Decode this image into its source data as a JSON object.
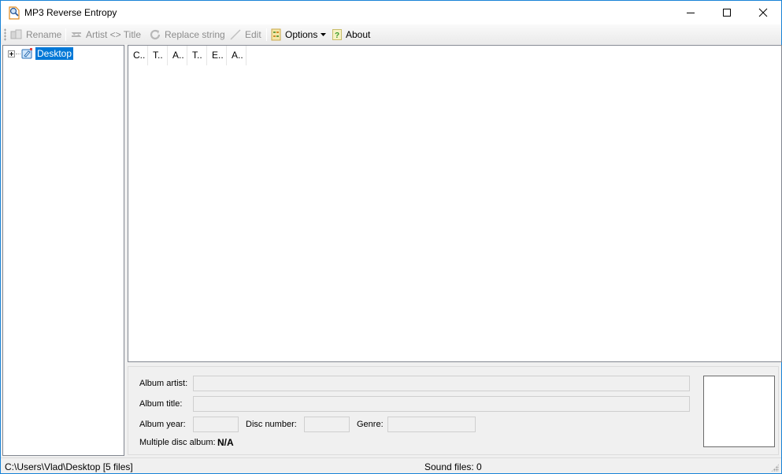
{
  "window": {
    "title": "MP3 Reverse Entropy",
    "controls": {
      "minimize": "minimize",
      "maximize": "maximize",
      "close": "close"
    }
  },
  "toolbar": {
    "items": [
      {
        "label": "Rename",
        "icon": "rename-icon",
        "enabled": false
      },
      {
        "label": "Artist <> Title",
        "icon": "swap-icon",
        "enabled": false
      },
      {
        "label": "Replace string",
        "icon": "refresh-icon",
        "enabled": false
      },
      {
        "label": "Edit",
        "icon": "pencil-icon",
        "enabled": false
      },
      {
        "label": "Options",
        "icon": "options-icon",
        "enabled": true,
        "dropdown": true
      },
      {
        "label": "About",
        "icon": "help-icon",
        "enabled": true
      }
    ]
  },
  "tree": {
    "nodes": [
      {
        "label": "Desktop",
        "selected": true,
        "expandable": true
      }
    ]
  },
  "list": {
    "columns": [
      "C..",
      "T..",
      "A..",
      "T..",
      "E..",
      "A.."
    ],
    "rows": []
  },
  "details": {
    "album_artist_label": "Album artist:",
    "album_artist_value": "",
    "album_title_label": "Album title:",
    "album_title_value": "",
    "album_year_label": "Album year:",
    "album_year_value": "",
    "disc_number_label": "Disc number:",
    "disc_number_value": "",
    "genre_label": "Genre:",
    "genre_value": "",
    "multi_disc_label": "Multiple disc album:",
    "multi_disc_value": "N/A"
  },
  "status": {
    "path": "C:\\Users\\Vlad\\Desktop [5 files]",
    "sound_files": "Sound files: 0"
  },
  "colors": {
    "accent": "#0078d7",
    "window_border": "#1883d7",
    "disabled_text": "#8d8d8d"
  }
}
